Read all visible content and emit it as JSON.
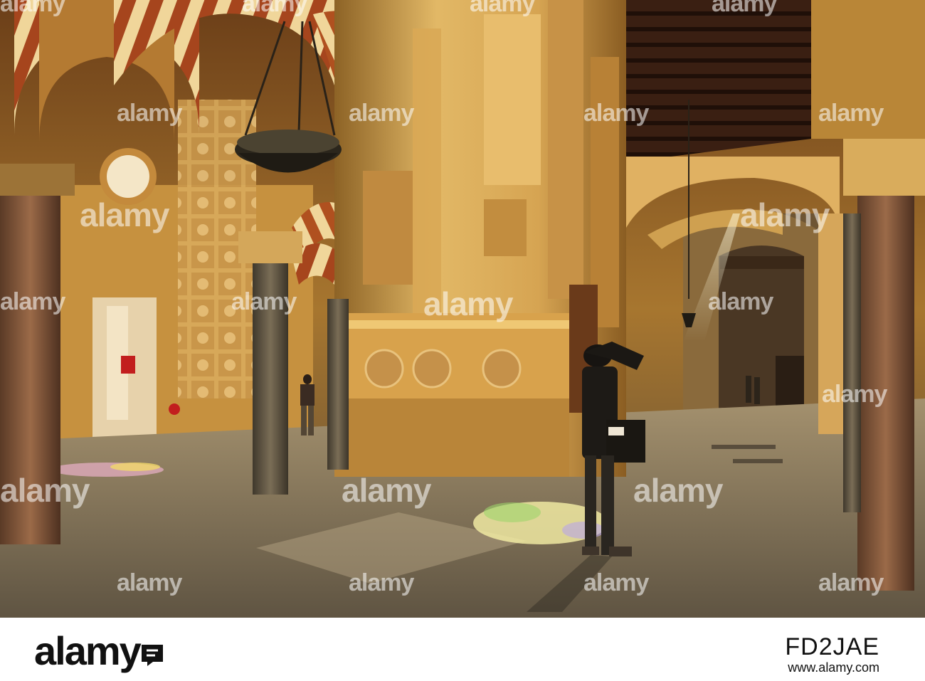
{
  "watermark": {
    "brand": "alamy"
  },
  "footer": {
    "logo": "alamy",
    "image_id": "FD2JAE",
    "url": "www.alamy.com"
  },
  "colors": {
    "stone": "#b9883a",
    "stone_light": "#e4bb6b",
    "arch_red": "#a6451d",
    "arch_cream": "#f0d69a",
    "ceiling": "#3a1f12",
    "floor": "#7b6b55",
    "column": "#5e5443"
  }
}
